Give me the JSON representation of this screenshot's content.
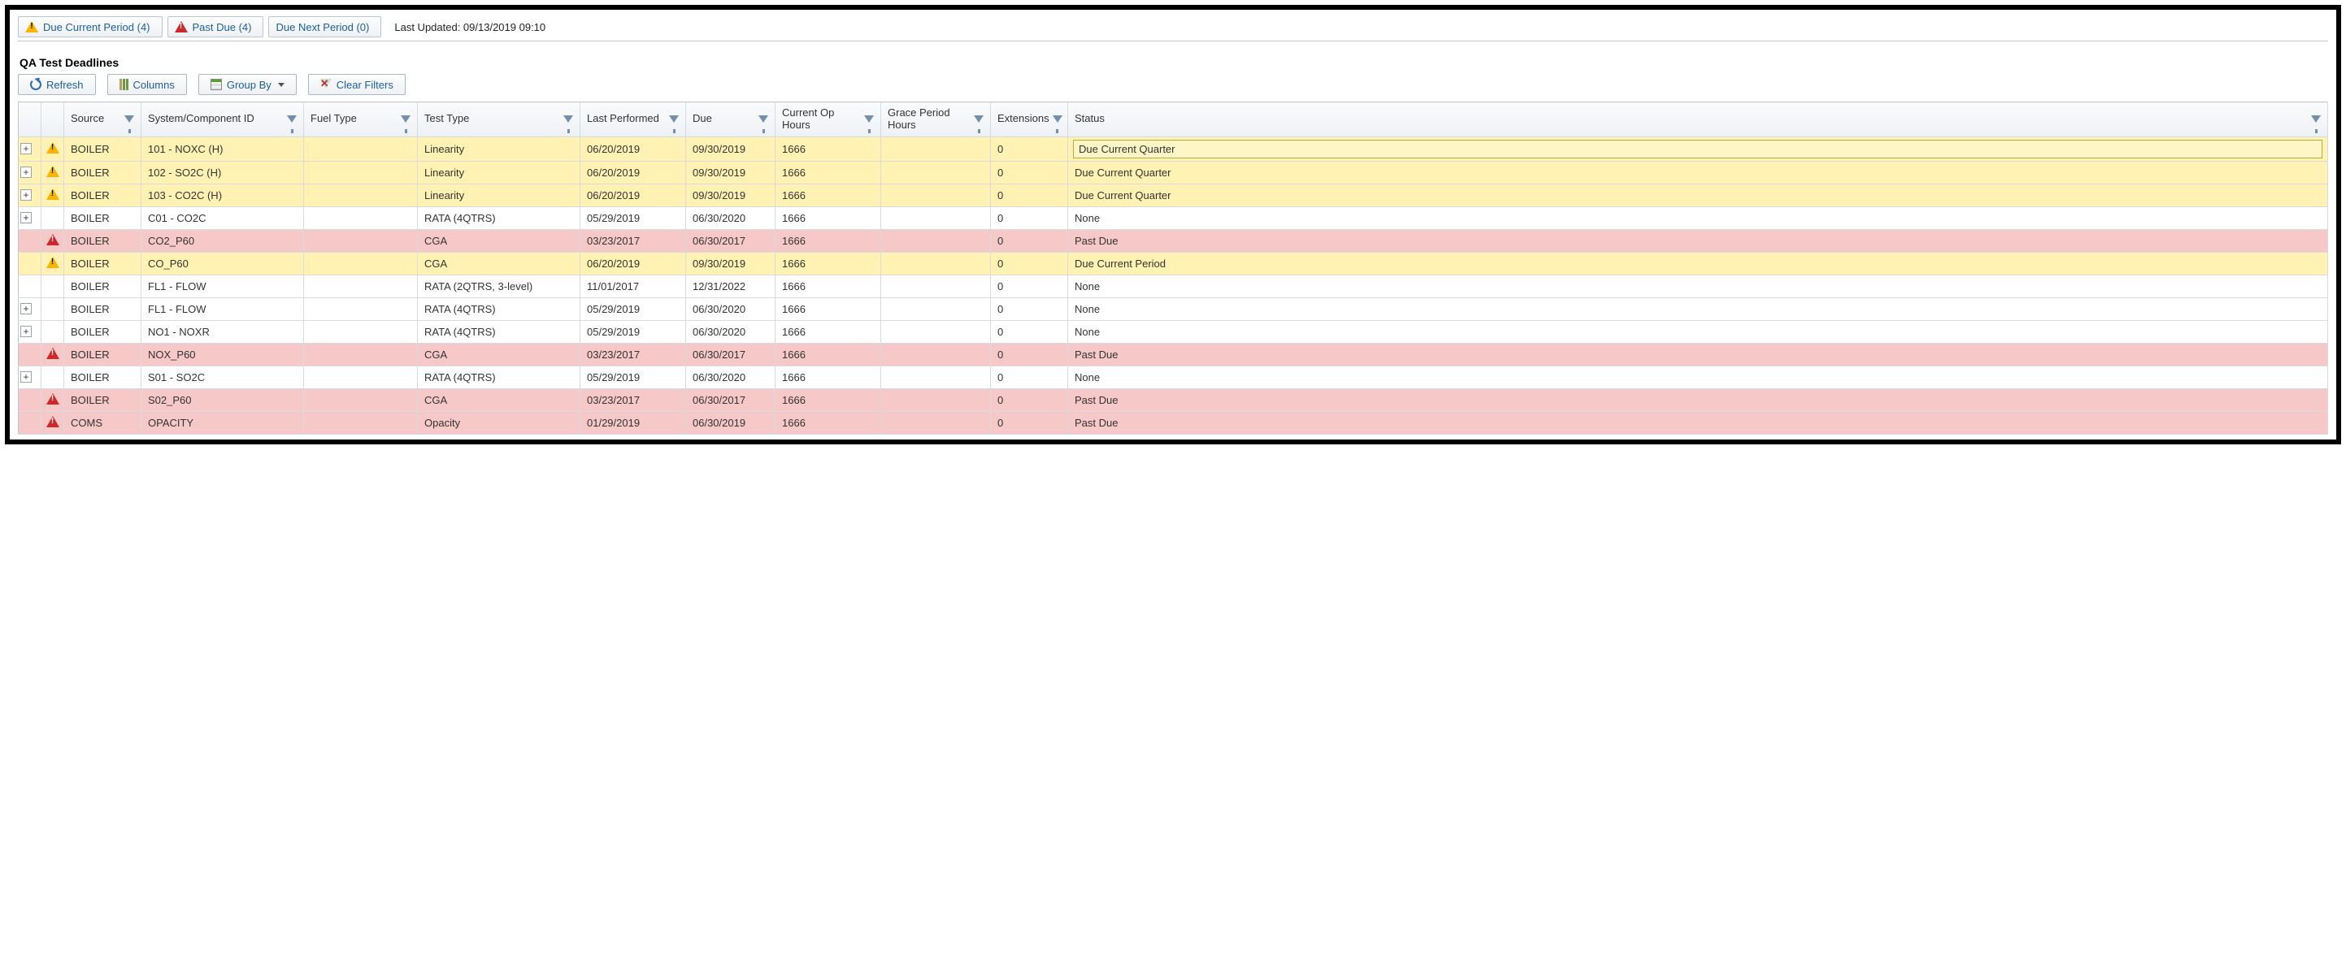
{
  "topbar": {
    "tabs": [
      {
        "icon": "warn",
        "label": "Due Current Period (4)"
      },
      {
        "icon": "danger",
        "label": "Past Due (4)"
      },
      {
        "icon": "",
        "label": "Due Next Period (0)"
      }
    ],
    "lastUpdated": "Last Updated:  09/13/2019 09:10"
  },
  "section": {
    "title": "QA Test Deadlines"
  },
  "toolbar": {
    "refresh": "Refresh",
    "columns": "Columns",
    "groupBy": "Group By",
    "clear": "Clear Filters"
  },
  "columns": [
    {
      "key": "expand",
      "label": ""
    },
    {
      "key": "icon",
      "label": ""
    },
    {
      "key": "source",
      "label": "Source",
      "filter": true
    },
    {
      "key": "system",
      "label": "System/Component ID",
      "filter": true
    },
    {
      "key": "fuel",
      "label": "Fuel Type",
      "filter": true
    },
    {
      "key": "test",
      "label": "Test Type",
      "filter": true
    },
    {
      "key": "last",
      "label": "Last Performed",
      "filter": true
    },
    {
      "key": "due",
      "label": "Due",
      "filter": true
    },
    {
      "key": "op",
      "label": "Current Op Hours",
      "filter": true
    },
    {
      "key": "grace",
      "label": "Grace Period Hours",
      "filter": true
    },
    {
      "key": "ext",
      "label": "Extensions",
      "filter": true
    },
    {
      "key": "status",
      "label": "Status",
      "filter": true
    }
  ],
  "rows": [
    {
      "expand": true,
      "icon": "warn",
      "rowcolor": "yellow",
      "source": "BOILER",
      "system": "101 - NOXC (H)",
      "fuel": "",
      "test": "Linearity",
      "last": "06/20/2019",
      "due": "09/30/2019",
      "op": "1666",
      "grace": "",
      "ext": "0",
      "status": "Due Current Quarter",
      "statusBoxed": true
    },
    {
      "expand": true,
      "icon": "warn",
      "rowcolor": "yellow",
      "source": "BOILER",
      "system": "102 - SO2C (H)",
      "fuel": "",
      "test": "Linearity",
      "last": "06/20/2019",
      "due": "09/30/2019",
      "op": "1666",
      "grace": "",
      "ext": "0",
      "status": "Due Current Quarter"
    },
    {
      "expand": true,
      "icon": "warn",
      "rowcolor": "yellow",
      "source": "BOILER",
      "system": "103 - CO2C (H)",
      "fuel": "",
      "test": "Linearity",
      "last": "06/20/2019",
      "due": "09/30/2019",
      "op": "1666",
      "grace": "",
      "ext": "0",
      "status": "Due Current Quarter"
    },
    {
      "expand": true,
      "icon": "",
      "rowcolor": "white",
      "source": "BOILER",
      "system": "C01 - CO2C",
      "fuel": "",
      "test": "RATA (4QTRS)",
      "last": "05/29/2019",
      "due": "06/30/2020",
      "op": "1666",
      "grace": "",
      "ext": "0",
      "status": "None"
    },
    {
      "expand": false,
      "icon": "danger",
      "rowcolor": "pink",
      "source": "BOILER",
      "system": "CO2_P60",
      "fuel": "",
      "test": "CGA",
      "last": "03/23/2017",
      "due": "06/30/2017",
      "op": "1666",
      "grace": "",
      "ext": "0",
      "status": "Past Due"
    },
    {
      "expand": false,
      "icon": "warn",
      "rowcolor": "yellow",
      "source": "BOILER",
      "system": "CO_P60",
      "fuel": "",
      "test": "CGA",
      "last": "06/20/2019",
      "due": "09/30/2019",
      "op": "1666",
      "grace": "",
      "ext": "0",
      "status": "Due Current Period"
    },
    {
      "expand": false,
      "icon": "",
      "rowcolor": "white",
      "source": "BOILER",
      "system": "FL1 - FLOW",
      "fuel": "",
      "test": "RATA (2QTRS, 3-level)",
      "last": "11/01/2017",
      "due": "12/31/2022",
      "op": "1666",
      "grace": "",
      "ext": "0",
      "status": "None"
    },
    {
      "expand": true,
      "icon": "",
      "rowcolor": "white",
      "source": "BOILER",
      "system": "FL1 - FLOW",
      "fuel": "",
      "test": "RATA (4QTRS)",
      "last": "05/29/2019",
      "due": "06/30/2020",
      "op": "1666",
      "grace": "",
      "ext": "0",
      "status": "None"
    },
    {
      "expand": true,
      "icon": "",
      "rowcolor": "white",
      "source": "BOILER",
      "system": "NO1 - NOXR",
      "fuel": "",
      "test": "RATA (4QTRS)",
      "last": "05/29/2019",
      "due": "06/30/2020",
      "op": "1666",
      "grace": "",
      "ext": "0",
      "status": "None"
    },
    {
      "expand": false,
      "icon": "danger",
      "rowcolor": "pink",
      "source": "BOILER",
      "system": "NOX_P60",
      "fuel": "",
      "test": "CGA",
      "last": "03/23/2017",
      "due": "06/30/2017",
      "op": "1666",
      "grace": "",
      "ext": "0",
      "status": "Past Due"
    },
    {
      "expand": true,
      "icon": "",
      "rowcolor": "white",
      "source": "BOILER",
      "system": "S01 - SO2C",
      "fuel": "",
      "test": "RATA (4QTRS)",
      "last": "05/29/2019",
      "due": "06/30/2020",
      "op": "1666",
      "grace": "",
      "ext": "0",
      "status": "None"
    },
    {
      "expand": false,
      "icon": "danger",
      "rowcolor": "pink",
      "source": "BOILER",
      "system": "S02_P60",
      "fuel": "",
      "test": "CGA",
      "last": "03/23/2017",
      "due": "06/30/2017",
      "op": "1666",
      "grace": "",
      "ext": "0",
      "status": "Past Due"
    },
    {
      "expand": false,
      "icon": "danger",
      "rowcolor": "pink",
      "source": "COMS",
      "system": "OPACITY",
      "fuel": "",
      "test": "Opacity",
      "last": "01/29/2019",
      "due": "06/30/2019",
      "op": "1666",
      "grace": "",
      "ext": "0",
      "status": "Past Due"
    }
  ]
}
